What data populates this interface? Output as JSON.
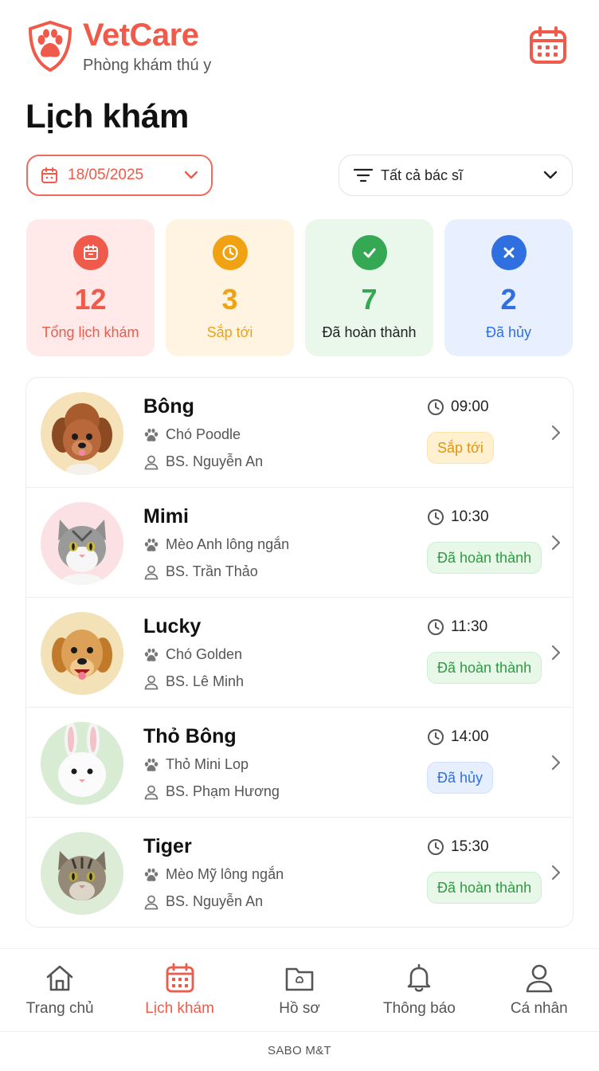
{
  "app": {
    "name": "VetCare",
    "subtitle": "Phòng khám thú y"
  },
  "page": {
    "title": "Lịch khám"
  },
  "filters": {
    "date": "18/05/2025",
    "doctor": "Tất cả bác sĩ"
  },
  "stats": [
    {
      "value": "12",
      "label": "Tổng lịch khám",
      "color": "#ef5a4a",
      "bg": "#ffe9e9",
      "icon": "calendar-icon"
    },
    {
      "value": "3",
      "label": "Sắp tới",
      "color": "#f0a212",
      "bg": "#fff3e2",
      "icon": "clock-icon"
    },
    {
      "value": "7",
      "label": "Đã hoàn thành",
      "color": "#34a853",
      "bg": "#eaf8ec",
      "icon": "check-icon"
    },
    {
      "value": "2",
      "label": "Đã hủy",
      "color": "#2f6fe0",
      "bg": "#e8f0ff",
      "icon": "x-icon"
    }
  ],
  "appointments": [
    {
      "name": "Bông",
      "breed": "Chó Poodle",
      "doctor": "BS. Nguyễn An",
      "time": "09:00",
      "status": "Sắp tới",
      "status_type": "upcoming",
      "avatar_bg": "#f6e2b8"
    },
    {
      "name": "Mimi",
      "breed": "Mèo Anh lông ngắn",
      "doctor": "BS. Trần Thảo",
      "time": "10:30",
      "status": "Đã hoàn thành",
      "status_type": "done",
      "avatar_bg": "#fbe1e3"
    },
    {
      "name": "Lucky",
      "breed": "Chó Golden",
      "doctor": "BS. Lê Minh",
      "time": "11:30",
      "status": "Đã hoàn thành",
      "status_type": "done",
      "avatar_bg": "#f3e1b8"
    },
    {
      "name": "Thỏ Bông",
      "breed": "Thỏ Mini Lop",
      "doctor": "BS. Phạm Hương",
      "time": "14:00",
      "status": "Đã hủy",
      "status_type": "cancelled",
      "avatar_bg": "#d7ecd3"
    },
    {
      "name": "Tiger",
      "breed": "Mèo Mỹ lông ngắn",
      "doctor": "BS. Nguyễn An",
      "time": "15:30",
      "status": "Đã hoàn thành",
      "status_type": "done",
      "avatar_bg": "#dcecd6"
    }
  ],
  "nav": [
    {
      "label": "Trang chủ",
      "icon": "home-icon",
      "active": false
    },
    {
      "label": "Lịch khám",
      "icon": "calendar-icon",
      "active": true
    },
    {
      "label": "Hồ sơ",
      "icon": "folder-icon",
      "active": false
    },
    {
      "label": "Thông báo",
      "icon": "bell-icon",
      "active": false
    },
    {
      "label": "Cá nhân",
      "icon": "user-icon",
      "active": false
    }
  ],
  "footer": "SABO M&T",
  "colors": {
    "accent": "#ef5a4a",
    "upcoming": "#f0a212",
    "done": "#34a853",
    "cancelled": "#2f6fe0"
  }
}
